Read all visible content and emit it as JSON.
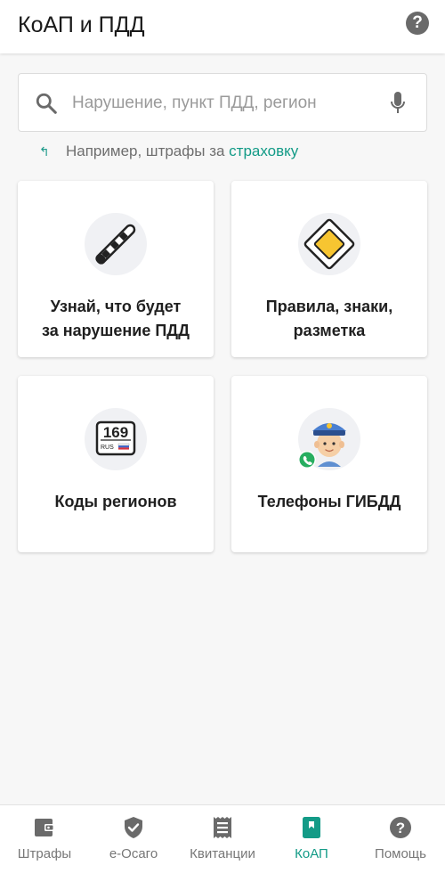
{
  "app_title": "КоАП и ПДД",
  "search": {
    "placeholder": "Нарушение, пункт ПДД, регион"
  },
  "hint": {
    "prefix": "Например, штрафы за ",
    "link": "страховку"
  },
  "cards": [
    {
      "label_line1": "Узнай, что будет",
      "label_line2": "за нарушение ПДД",
      "icon": "baton-icon"
    },
    {
      "label_line1": "Правила, знаки,",
      "label_line2": "разметка",
      "icon": "priority-road-sign-icon"
    },
    {
      "label": "Коды регионов",
      "icon": "license-plate-icon",
      "plate_number": "169",
      "plate_country": "RUS"
    },
    {
      "label": "Телефоны ГИБДД",
      "icon": "traffic-officer-icon"
    }
  ],
  "bottom_nav": [
    {
      "label": "Штрафы",
      "icon": "wallet-icon",
      "active": false
    },
    {
      "label": "е-Осаго",
      "icon": "shield-check-icon",
      "active": false
    },
    {
      "label": "Квитанции",
      "icon": "receipt-icon",
      "active": false
    },
    {
      "label": "КоАП",
      "icon": "book-icon",
      "active": true
    },
    {
      "label": "Помощь",
      "icon": "help-icon",
      "active": false
    }
  ],
  "colors": {
    "accent": "#139b87",
    "icon_gray": "#6a6a6a",
    "sign_yellow": "#f7c531"
  }
}
